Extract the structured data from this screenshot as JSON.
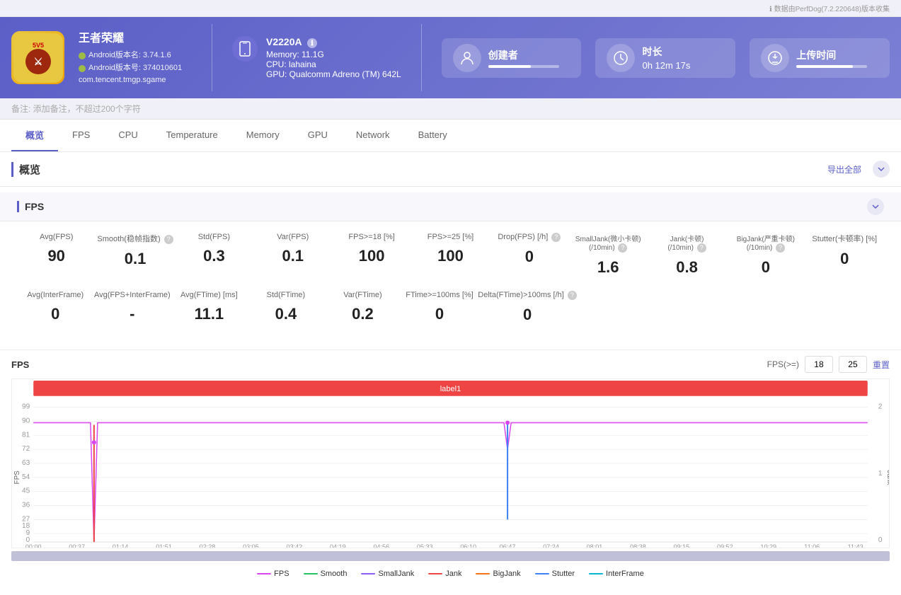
{
  "header": {
    "top_note": "数据由PerfDog(7.2.220648)版本收集",
    "game_title": "王者荣耀",
    "android_version1": "Android版本名: 3.74.1.6",
    "android_version2": "Android版本号: 374010601",
    "package": "com.tencent.tmgp.sgame",
    "device_name": "V2220A",
    "memory": "Memory: 11.1G",
    "cpu": "CPU: lahaina",
    "gpu": "GPU: Qualcomm Adreno (TM) 642L",
    "creator_label": "创建者",
    "duration_label": "时长",
    "duration_value": "0h 12m 17s",
    "upload_label": "上传时间"
  },
  "notes_bar": {
    "placeholder": "备注: 添加备注，不超过200个字符"
  },
  "nav": {
    "tabs": [
      "概览",
      "FPS",
      "CPU",
      "Temperature",
      "Memory",
      "GPU",
      "Network",
      "Battery"
    ]
  },
  "overview": {
    "title": "概览",
    "export_label": "导出全部",
    "fps_section_title": "FPS",
    "fps_gte_label": "FPS(>=)",
    "fps_gte_18": "18",
    "fps_gte_25": "25",
    "reset_label": "重置"
  },
  "fps_stats": {
    "row1": [
      {
        "label": "Avg(FPS)",
        "value": "90",
        "has_help": false
      },
      {
        "label": "Smooth(稳帧指数)",
        "value": "0.1",
        "has_help": true
      },
      {
        "label": "Std(FPS)",
        "value": "0.3",
        "has_help": false
      },
      {
        "label": "Var(FPS)",
        "value": "0.1",
        "has_help": false
      },
      {
        "label": "FPS>=18 [%]",
        "value": "100",
        "has_help": false
      },
      {
        "label": "FPS>=25 [%]",
        "value": "100",
        "has_help": false
      },
      {
        "label": "Drop(FPS) [/h]",
        "value": "0",
        "has_help": true
      },
      {
        "label": "SmallJank(微小卡顿) (/10min)",
        "value": "1.6",
        "has_help": true
      },
      {
        "label": "Jank(卡顿) (/10min)",
        "value": "0.8",
        "has_help": true
      },
      {
        "label": "BigJank(严重卡顿) (/10min)",
        "value": "0",
        "has_help": true
      },
      {
        "label": "Stutter(卡顿率) [%]",
        "value": "0",
        "has_help": false
      }
    ],
    "row2": [
      {
        "label": "Avg(InterFrame)",
        "value": "0",
        "has_help": false
      },
      {
        "label": "Avg(FPS+InterFrame)",
        "value": "-",
        "has_help": false
      },
      {
        "label": "Avg(FTime) [ms]",
        "value": "11.1",
        "has_help": false
      },
      {
        "label": "Std(FTime)",
        "value": "0.4",
        "has_help": false
      },
      {
        "label": "Var(FTime)",
        "value": "0.2",
        "has_help": false
      },
      {
        "label": "FTime>=100ms [%]",
        "value": "0",
        "has_help": false
      },
      {
        "label": "Delta(FTime)>100ms [/h]",
        "value": "0",
        "has_help": true
      }
    ]
  },
  "chart": {
    "label1": "label1",
    "y_labels": [
      "99",
      "90",
      "81",
      "72",
      "63",
      "54",
      "45",
      "36",
      "27",
      "18",
      "9",
      "0"
    ],
    "x_labels": [
      "00:00",
      "00:37",
      "01:14",
      "01:51",
      "02:28",
      "03:05",
      "03:42",
      "04:19",
      "04:56",
      "05:33",
      "06:10",
      "06:47",
      "07:24",
      "08:01",
      "08:38",
      "09:15",
      "09:52",
      "10:29",
      "11:06",
      "11:43"
    ],
    "right_y_labels": [
      "2",
      "1",
      "0"
    ],
    "y_axis_label_fps": "FPS",
    "y_axis_label_jank": "Jank"
  },
  "legend": {
    "items": [
      {
        "name": "FPS",
        "color_class": "fps"
      },
      {
        "name": "Smooth",
        "color_class": "smooth"
      },
      {
        "name": "SmallJank",
        "color_class": "smalljank"
      },
      {
        "name": "Jank",
        "color_class": "jank"
      },
      {
        "name": "BigJank",
        "color_class": "bigjank"
      },
      {
        "name": "Stutter",
        "color_class": "stutter"
      },
      {
        "name": "InterFrame",
        "color_class": "interframe"
      }
    ]
  }
}
